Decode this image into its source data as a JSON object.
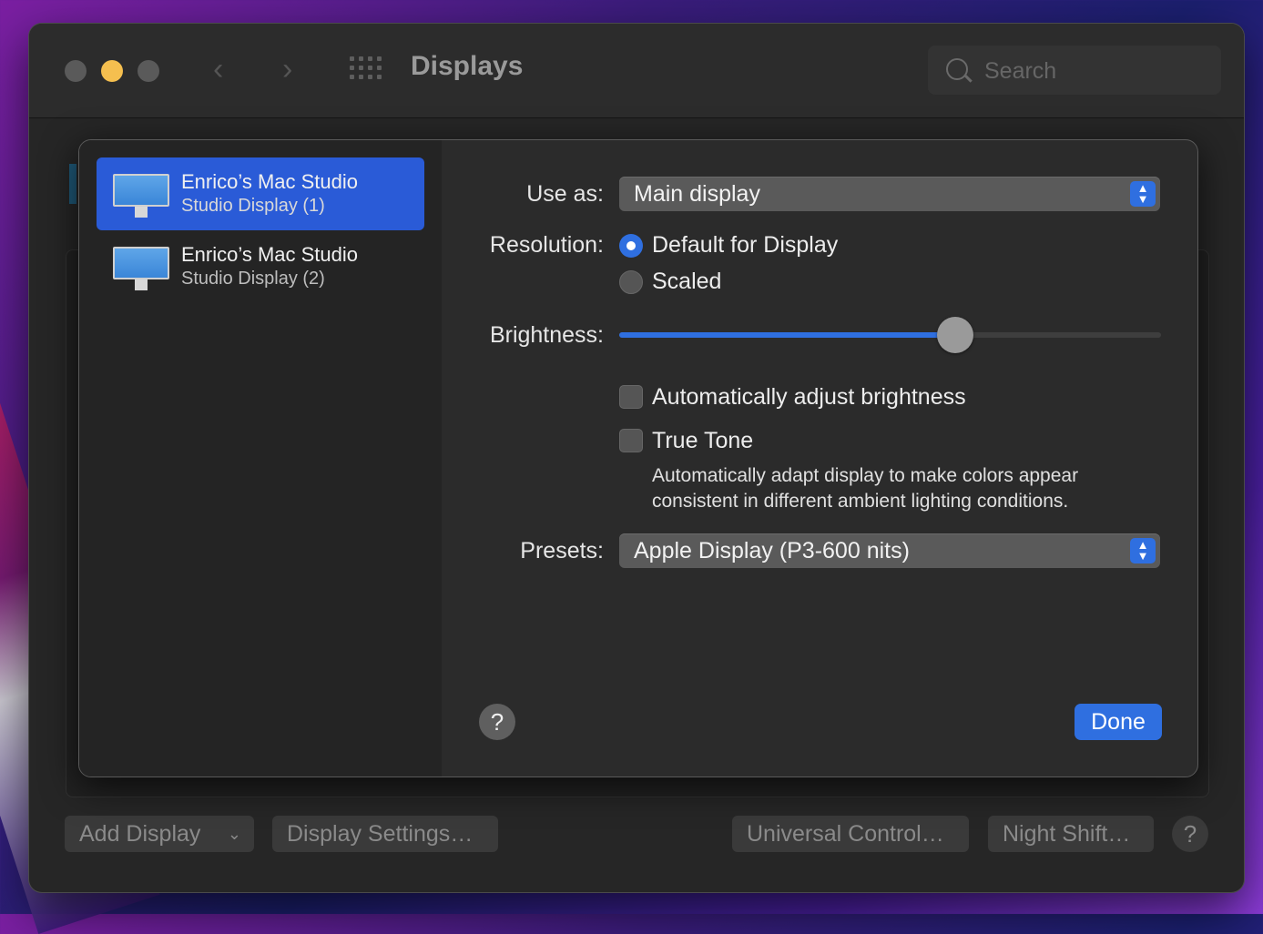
{
  "window": {
    "title": "Displays"
  },
  "search": {
    "placeholder": "Search"
  },
  "footer": {
    "add_display": "Add Display",
    "display_settings": "Display Settings…",
    "universal_control": "Universal Control…",
    "night_shift": "Night Shift…",
    "help": "?"
  },
  "sidebar": {
    "items": [
      {
        "name": "Enrico’s Mac Studio",
        "subtitle": "Studio Display (1)",
        "selected": true
      },
      {
        "name": "Enrico’s Mac Studio",
        "subtitle": "Studio Display (2)",
        "selected": false
      }
    ]
  },
  "settings": {
    "use_as_label": "Use as:",
    "use_as_value": "Main display",
    "resolution_label": "Resolution:",
    "resolution_options": [
      "Default for Display",
      "Scaled"
    ],
    "resolution_selected": "Default for Display",
    "brightness_label": "Brightness:",
    "brightness_value": 0.62,
    "auto_brightness_label": "Automatically adjust brightness",
    "auto_brightness_checked": false,
    "true_tone_label": "True Tone",
    "true_tone_checked": false,
    "true_tone_description": "Automatically adapt display to make colors appear consistent in different ambient lighting conditions.",
    "presets_label": "Presets:",
    "presets_value": "Apple Display (P3-600 nits)"
  },
  "sheet": {
    "help": "?",
    "done": "Done"
  },
  "colors": {
    "accent": "#2f6fe0",
    "selection": "#2a5bd7"
  }
}
